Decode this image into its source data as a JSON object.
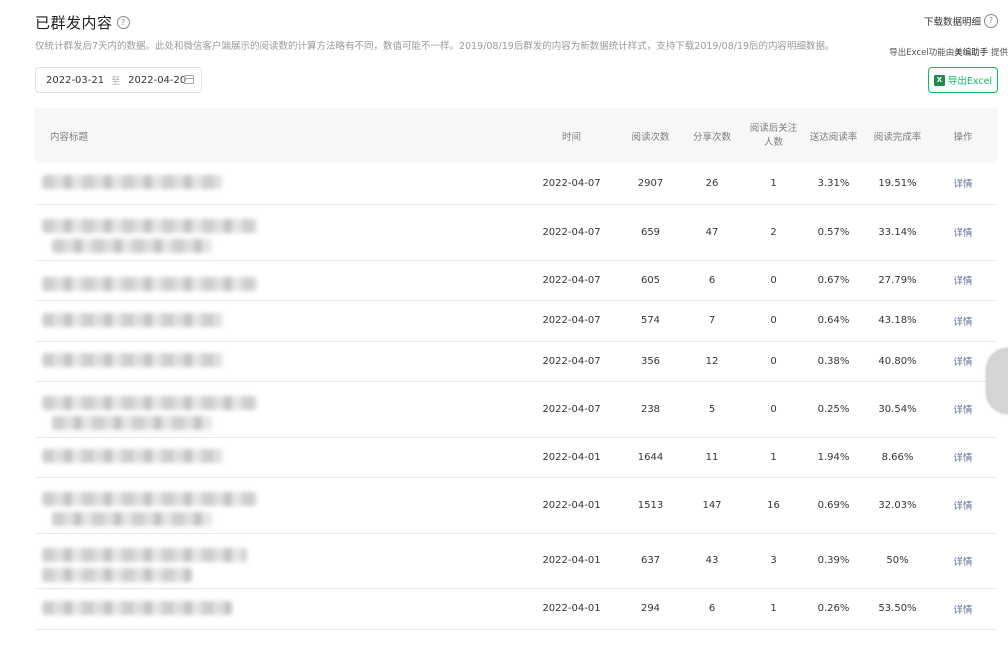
{
  "header": {
    "title": "已群发内容",
    "subtitle": "仅统计群发后7天内的数据。此处和微信客户端展示的阅读数的计算方法略有不同，数值可能不一样。2019/08/19后群发的内容为新数据统计样式，支持下载2019/08/19后的内容明细数据。",
    "download_detail": "下载数据明细",
    "export_note_prefix": "导出Excel功能由",
    "export_note_brand": "美编助手",
    "export_note_suffix": "提供"
  },
  "date_range": {
    "start": "2022-03-21",
    "separator": "至",
    "end": "2022-04-20"
  },
  "export_button": {
    "label": "导出Excel"
  },
  "table": {
    "columns": {
      "title": "内容标题",
      "time": "时间",
      "reads": "阅读次数",
      "shares": "分享次数",
      "follows": "阅读后关注人数",
      "delivery_rate": "送达阅读率",
      "completion_rate": "阅读完成率",
      "action": "操作"
    },
    "rows": [
      {
        "time": "2022-04-07",
        "reads": "2907",
        "shares": "26",
        "follows": "1",
        "delivery_rate": "3.31%",
        "completion_rate": "19.51%",
        "action": "详情"
      },
      {
        "time": "2022-04-07",
        "reads": "659",
        "shares": "47",
        "follows": "2",
        "delivery_rate": "0.57%",
        "completion_rate": "33.14%",
        "action": "详情"
      },
      {
        "time": "2022-04-07",
        "reads": "605",
        "shares": "6",
        "follows": "0",
        "delivery_rate": "0.67%",
        "completion_rate": "27.79%",
        "action": "详情"
      },
      {
        "time": "2022-04-07",
        "reads": "574",
        "shares": "7",
        "follows": "0",
        "delivery_rate": "0.64%",
        "completion_rate": "43.18%",
        "action": "详情"
      },
      {
        "time": "2022-04-07",
        "reads": "356",
        "shares": "12",
        "follows": "0",
        "delivery_rate": "0.38%",
        "completion_rate": "40.80%",
        "action": "详情"
      },
      {
        "time": "2022-04-07",
        "reads": "238",
        "shares": "5",
        "follows": "0",
        "delivery_rate": "0.25%",
        "completion_rate": "30.54%",
        "action": "详情"
      },
      {
        "time": "2022-04-01",
        "reads": "1644",
        "shares": "11",
        "follows": "1",
        "delivery_rate": "1.94%",
        "completion_rate": "8.66%",
        "action": "详情"
      },
      {
        "time": "2022-04-01",
        "reads": "1513",
        "shares": "147",
        "follows": "16",
        "delivery_rate": "0.69%",
        "completion_rate": "32.03%",
        "action": "详情"
      },
      {
        "time": "2022-04-01",
        "reads": "637",
        "shares": "43",
        "follows": "3",
        "delivery_rate": "0.39%",
        "completion_rate": "50%",
        "action": "详情"
      },
      {
        "time": "2022-04-01",
        "reads": "294",
        "shares": "6",
        "follows": "1",
        "delivery_rate": "0.26%",
        "completion_rate": "53.50%",
        "action": "详情"
      }
    ]
  },
  "colors": {
    "accent_green": "#07c160",
    "link_blue": "#576b95",
    "header_bg": "#f6f7f8"
  }
}
